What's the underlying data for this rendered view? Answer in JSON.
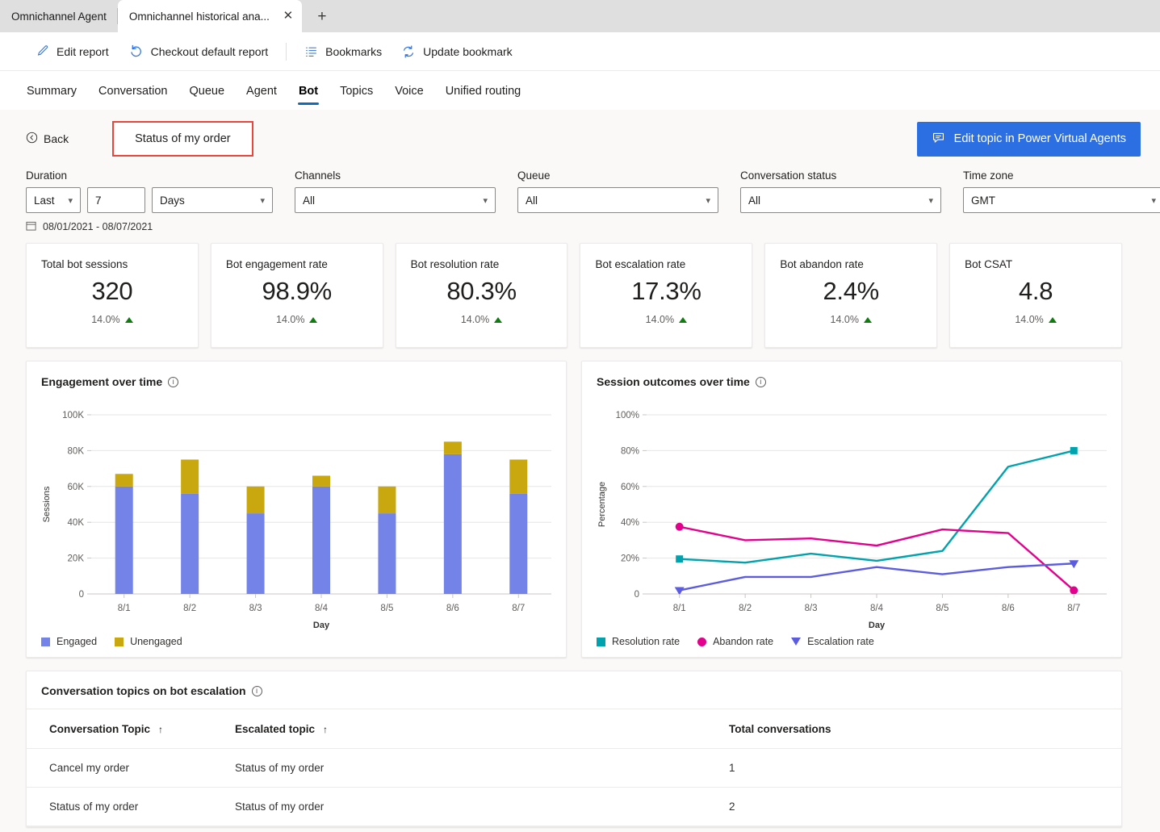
{
  "browser": {
    "tabs": [
      {
        "title": "Omnichannel Agent",
        "active": false
      },
      {
        "title": "Omnichannel historical ana...",
        "active": true
      }
    ],
    "close_icon": "close-icon",
    "new_tab_icon": "plus-icon"
  },
  "commandbar": {
    "items": [
      {
        "label": "Edit report",
        "icon": "pencil-icon"
      },
      {
        "label": "Checkout default report",
        "icon": "undo-icon"
      },
      {
        "label": "Bookmarks",
        "icon": "bookmark-list-icon"
      },
      {
        "label": "Update bookmark",
        "icon": "refresh-icon"
      }
    ]
  },
  "pivot": {
    "items": [
      "Summary",
      "Conversation",
      "Queue",
      "Agent",
      "Bot",
      "Topics",
      "Voice",
      "Unified routing"
    ],
    "selected": "Bot"
  },
  "subheader": {
    "back_label": "Back",
    "back_icon": "back-circle-icon",
    "topic_title": "Status of my order",
    "topic_highlight_color": "#e8453c",
    "pva_button_label": "Edit topic in Power Virtual Agents",
    "pva_button_icon": "chat-bot-icon",
    "pva_button_color": "#2b6fe3"
  },
  "filters": {
    "duration": {
      "label": "Duration",
      "mode": "Last",
      "amount": "7",
      "unit": "Days"
    },
    "channels": {
      "label": "Channels",
      "value": "All"
    },
    "queue": {
      "label": "Queue",
      "value": "All"
    },
    "conversation_status": {
      "label": "Conversation status",
      "value": "All"
    },
    "time_zone": {
      "label": "Time zone",
      "value": "GMT"
    },
    "date_range": "08/01/2021 - 08/07/2021",
    "calendar_icon": "calendar-icon"
  },
  "kpis": [
    {
      "title": "Total bot sessions",
      "value": "320",
      "delta": "14.0%",
      "trend": "up"
    },
    {
      "title": "Bot engagement rate",
      "value": "98.9%",
      "delta": "14.0%",
      "trend": "up"
    },
    {
      "title": "Bot resolution rate",
      "value": "80.3%",
      "delta": "14.0%",
      "trend": "up"
    },
    {
      "title": "Bot escalation rate",
      "value": "17.3%",
      "delta": "14.0%",
      "trend": "up"
    },
    {
      "title": "Bot abandon rate",
      "value": "2.4%",
      "delta": "14.0%",
      "trend": "up"
    },
    {
      "title": "Bot CSAT",
      "value": "4.8",
      "delta": "14.0%",
      "trend": "up"
    }
  ],
  "charts": {
    "engagement": {
      "title": "Engagement over time",
      "info_icon": "info-icon",
      "legend": [
        {
          "label": "Engaged",
          "color": "#7383e8",
          "marker": "square"
        },
        {
          "label": "Unengaged",
          "color": "#c9a80f",
          "marker": "square"
        }
      ]
    },
    "outcomes": {
      "title": "Session outcomes over time",
      "info_icon": "info-icon",
      "legend": [
        {
          "label": "Resolution rate",
          "color": "#00a2ad",
          "marker": "square"
        },
        {
          "label": "Abandon rate",
          "color": "#e3008c",
          "marker": "circle"
        },
        {
          "label": "Escalation rate",
          "color": "#5c5ce0",
          "marker": "triangle-down"
        }
      ]
    }
  },
  "chart_data": [
    {
      "type": "bar",
      "title": "Engagement over time",
      "stacked": true,
      "categories": [
        "8/1",
        "8/2",
        "8/3",
        "8/4",
        "8/5",
        "8/6",
        "8/7"
      ],
      "series": [
        {
          "name": "Engaged",
          "color": "#7383e8",
          "values": [
            60000,
            56000,
            45000,
            60000,
            45000,
            78000,
            56000
          ]
        },
        {
          "name": "Unengaged",
          "color": "#c9a80f",
          "values": [
            7000,
            19000,
            15000,
            6000,
            15000,
            7000,
            19000
          ]
        }
      ],
      "totals": [
        67000,
        75000,
        60000,
        66000,
        60000,
        85000,
        75000
      ],
      "xlabel": "Day",
      "ylabel": "Sessions",
      "ylim": [
        0,
        100000
      ],
      "yticks": [
        "0",
        "20K",
        "40K",
        "60K",
        "80K",
        "100K"
      ],
      "grid": true,
      "legend_position": "bottom-left"
    },
    {
      "type": "line",
      "title": "Session outcomes over time",
      "x": [
        "8/1",
        "8/2",
        "8/3",
        "8/4",
        "8/5",
        "8/6",
        "8/7"
      ],
      "series": [
        {
          "name": "Resolution rate",
          "color": "#00a2ad",
          "marker": "square",
          "values": [
            19.5,
            17.5,
            22.5,
            18.5,
            24,
            71,
            80
          ]
        },
        {
          "name": "Abandon rate",
          "color": "#e3008c",
          "marker": "circle",
          "values": [
            37.5,
            30,
            31,
            27,
            36,
            34,
            2
          ]
        },
        {
          "name": "Escalation rate",
          "color": "#5c5ce0",
          "marker": "triangle-down",
          "values": [
            2,
            9.5,
            9.5,
            15,
            11,
            15,
            17
          ]
        }
      ],
      "xlabel": "Day",
      "ylabel": "Percentage",
      "ylim": [
        0,
        100
      ],
      "yticks": [
        "0",
        "20%",
        "40%",
        "60%",
        "80%",
        "100%"
      ],
      "grid": true,
      "legend_position": "bottom-left"
    }
  ],
  "table": {
    "title": "Conversation topics on bot escalation",
    "info_icon": "info-icon",
    "columns": [
      {
        "label": "Conversation Topic",
        "sort": "↑"
      },
      {
        "label": "Escalated topic",
        "sort": "↑"
      },
      {
        "label": "Total conversations",
        "sort": ""
      }
    ],
    "rows": [
      {
        "topic": "Cancel my order",
        "escalated": "Status of my order",
        "total": "1"
      },
      {
        "topic": "Status of my order",
        "escalated": "Status of my order",
        "total": "2"
      }
    ]
  }
}
